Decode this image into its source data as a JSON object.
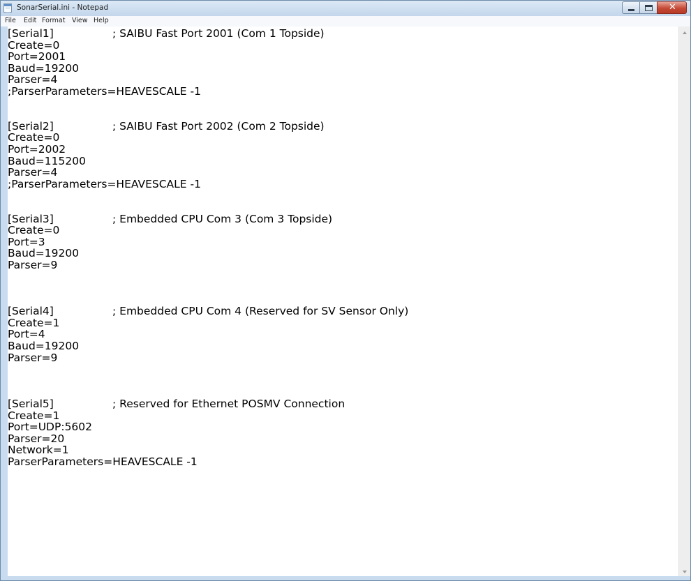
{
  "window": {
    "title": "SonarSerial.ini - Notepad",
    "close_symbol": "✕",
    "colors": {
      "frame": "#c9dcef",
      "close_button": "#c44a36",
      "text": "#000000",
      "background": "#ffffff"
    }
  },
  "menu": {
    "items": [
      "File",
      "Edit",
      "Format",
      "View",
      "Help"
    ]
  },
  "document": {
    "lines": [
      {
        "t": "[Serial1]",
        "c": "; SAIBU Fast Port 2001 (Com 1 Topside)"
      },
      {
        "t": "Create=0"
      },
      {
        "t": "Port=2001"
      },
      {
        "t": "Baud=19200"
      },
      {
        "t": "Parser=4"
      },
      {
        "t": ";ParserParameters=HEAVESCALE -1"
      },
      {
        "t": ""
      },
      {
        "t": ""
      },
      {
        "t": "[Serial2]",
        "c": "; SAIBU Fast Port 2002 (Com 2 Topside)"
      },
      {
        "t": "Create=0"
      },
      {
        "t": "Port=2002"
      },
      {
        "t": "Baud=115200"
      },
      {
        "t": "Parser=4"
      },
      {
        "t": ";ParserParameters=HEAVESCALE -1"
      },
      {
        "t": ""
      },
      {
        "t": ""
      },
      {
        "t": "[Serial3]",
        "c": "; Embedded CPU Com 3 (Com 3 Topside)"
      },
      {
        "t": "Create=0"
      },
      {
        "t": "Port=3"
      },
      {
        "t": "Baud=19200"
      },
      {
        "t": "Parser=9"
      },
      {
        "t": ""
      },
      {
        "t": ""
      },
      {
        "t": ""
      },
      {
        "t": "[Serial4]",
        "c": "; Embedded CPU Com 4 (Reserved for SV Sensor Only)"
      },
      {
        "t": "Create=1"
      },
      {
        "t": "Port=4"
      },
      {
        "t": "Baud=19200"
      },
      {
        "t": "Parser=9"
      },
      {
        "t": ""
      },
      {
        "t": ""
      },
      {
        "t": ""
      },
      {
        "t": "[Serial5]",
        "c": "; Reserved for Ethernet POSMV Connection"
      },
      {
        "t": "Create=1"
      },
      {
        "t": "Port=UDP:5602"
      },
      {
        "t": "Parser=20"
      },
      {
        "t": "Network=1"
      },
      {
        "t": "ParserParameters=HEAVESCALE -1"
      }
    ]
  }
}
